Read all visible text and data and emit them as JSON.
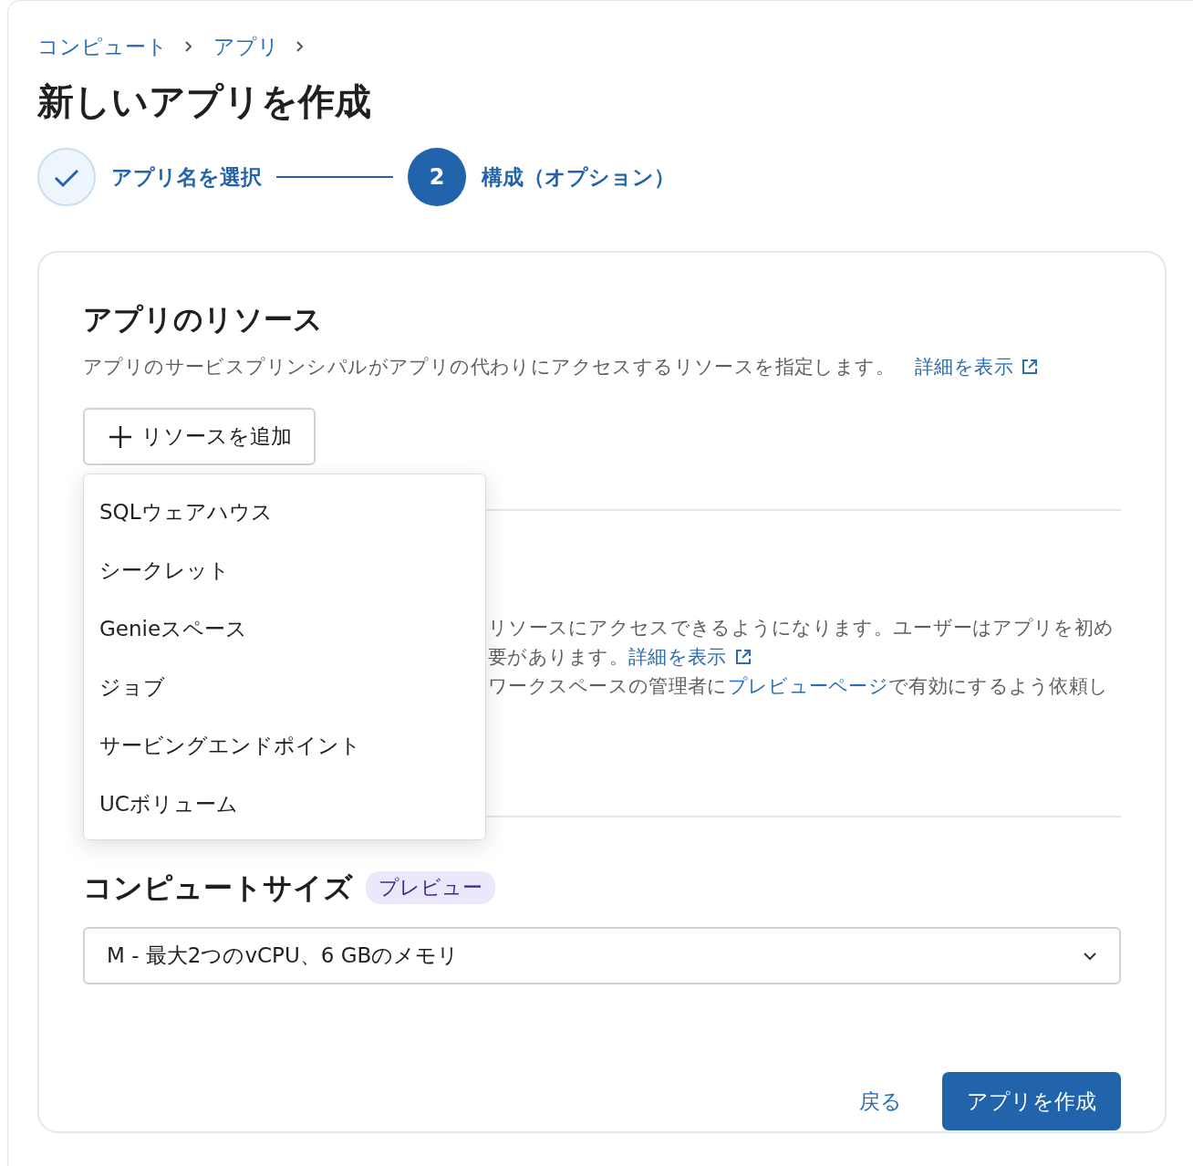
{
  "breadcrumb": [
    {
      "label": "コンピュート"
    },
    {
      "label": "アプリ"
    }
  ],
  "title": "新しいアプリを作成",
  "steps": [
    {
      "label": "アプリ名を選択",
      "kind": "done"
    },
    {
      "number": "2",
      "label": "構成（オプション）",
      "kind": "current"
    }
  ],
  "resources": {
    "heading": "アプリのリソース",
    "description": "アプリのサービスプリンシパルがアプリの代わりにアクセスするリソースを指定します。",
    "link": "詳細を表示",
    "add_button": "リソースを追加"
  },
  "resource_menu": [
    {
      "label": "SQLウェアハウス"
    },
    {
      "label": "シークレット"
    },
    {
      "label": "Genieスペース"
    },
    {
      "label": "ジョブ"
    },
    {
      "label": "サービングエンドポイント"
    },
    {
      "label": "UCボリューム"
    }
  ],
  "auth_section": {
    "lines": [
      [
        {
          "kind": "text",
          "text": "リソースにアクセスできるようになります。ユーザーはアプリを初め"
        }
      ],
      [
        {
          "kind": "text",
          "text": "要があります。"
        },
        {
          "kind": "link",
          "text": "詳細を表示",
          "external": true
        }
      ],
      [
        {
          "kind": "text",
          "text": "ワークスペースの管理者に"
        },
        {
          "kind": "link",
          "text": "プレビューページ",
          "external": false
        },
        {
          "kind": "text",
          "text": "で有効にするよう依頼し"
        }
      ]
    ]
  },
  "compute": {
    "heading": "コンピュートサイズ",
    "badge": "プレビュー",
    "value": "M - 最大2つのvCPU、6 GBのメモリ"
  },
  "actions": {
    "back": "戻る",
    "create": "アプリを作成"
  }
}
